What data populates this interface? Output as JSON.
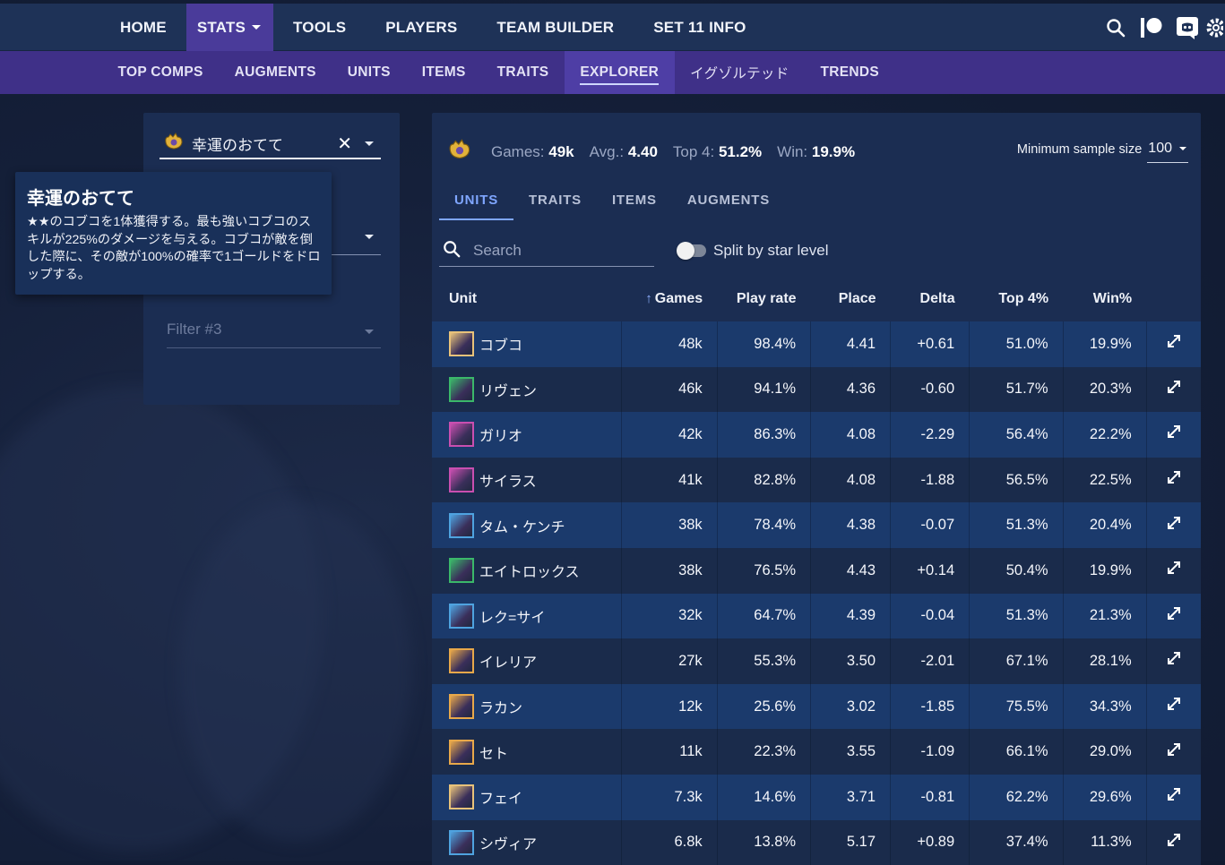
{
  "topnav": {
    "items": [
      {
        "label": "HOME"
      },
      {
        "label": "STATS"
      },
      {
        "label": "TOOLS"
      },
      {
        "label": "PLAYERS"
      },
      {
        "label": "TEAM BUILDER"
      },
      {
        "label": "SET 11 INFO"
      }
    ],
    "icons": [
      "search-icon",
      "patreon-icon",
      "discord-icon",
      "settings-icon"
    ]
  },
  "subnav": {
    "items": [
      {
        "label": "TOP COMPS"
      },
      {
        "label": "AUGMENTS"
      },
      {
        "label": "UNITS"
      },
      {
        "label": "ITEMS"
      },
      {
        "label": "TRAITS"
      },
      {
        "label": "EXPLORER"
      },
      {
        "label": "イグゾルテッド"
      },
      {
        "label": "TRENDS"
      }
    ]
  },
  "filters": {
    "filter1_value": "幸運のおてて",
    "filter3_placeholder": "Filter #3"
  },
  "tooltip": {
    "title": "幸運のおてて",
    "description": "★★のコブコを1体獲得する。最も強いコブコのスキルが225%のダメージを与える。コブコが敵を倒した際に、その敵が100%の確率で1ゴールドをドロップする。"
  },
  "summary": {
    "games_label": "Games:",
    "games_value": "49k",
    "avg_label": "Avg.:",
    "avg_value": "4.40",
    "top4_label": "Top 4:",
    "top4_value": "51.2%",
    "win_label": "Win:",
    "win_value": "19.9%",
    "sample_label": "Minimum sample size",
    "sample_value": "100"
  },
  "tabs": [
    {
      "label": "UNITS"
    },
    {
      "label": "TRAITS"
    },
    {
      "label": "ITEMS"
    },
    {
      "label": "AUGMENTS"
    }
  ],
  "search": {
    "placeholder": "Search"
  },
  "toggle": {
    "label": "Split by star level"
  },
  "table": {
    "headers": {
      "unit": "Unit",
      "games": "Games",
      "play": "Play rate",
      "place": "Place",
      "delta": "Delta",
      "top4": "Top 4%",
      "win": "Win%"
    },
    "rows": [
      {
        "unit": "コブコ",
        "games": "48k",
        "play": "98.4%",
        "place": "4.41",
        "delta": "+0.61",
        "top4": "51.0%",
        "win": "19.9%",
        "color": "#e8c27a"
      },
      {
        "unit": "リヴェン",
        "games": "46k",
        "play": "94.1%",
        "place": "4.36",
        "delta": "-0.60",
        "top4": "51.7%",
        "win": "20.3%",
        "color": "#3bb86a"
      },
      {
        "unit": "ガリオ",
        "games": "42k",
        "play": "86.3%",
        "place": "4.08",
        "delta": "-2.29",
        "top4": "56.4%",
        "win": "22.2%",
        "color": "#c94fb0"
      },
      {
        "unit": "サイラス",
        "games": "41k",
        "play": "82.8%",
        "place": "4.08",
        "delta": "-1.88",
        "top4": "56.5%",
        "win": "22.5%",
        "color": "#c94fb0"
      },
      {
        "unit": "タム・ケンチ",
        "games": "38k",
        "play": "78.4%",
        "place": "4.38",
        "delta": "-0.07",
        "top4": "51.3%",
        "win": "20.4%",
        "color": "#4fa3e0"
      },
      {
        "unit": "エイトロックス",
        "games": "38k",
        "play": "76.5%",
        "place": "4.43",
        "delta": "+0.14",
        "top4": "50.4%",
        "win": "19.9%",
        "color": "#3bb86a"
      },
      {
        "unit": "レク=サイ",
        "games": "32k",
        "play": "64.7%",
        "place": "4.39",
        "delta": "-0.04",
        "top4": "51.3%",
        "win": "21.3%",
        "color": "#4fa3e0"
      },
      {
        "unit": "イレリア",
        "games": "27k",
        "play": "55.3%",
        "place": "3.50",
        "delta": "-2.01",
        "top4": "67.1%",
        "win": "28.1%",
        "color": "#e8a84a"
      },
      {
        "unit": "ラカン",
        "games": "12k",
        "play": "25.6%",
        "place": "3.02",
        "delta": "-1.85",
        "top4": "75.5%",
        "win": "34.3%",
        "color": "#e8a84a"
      },
      {
        "unit": "セト",
        "games": "11k",
        "play": "22.3%",
        "place": "3.55",
        "delta": "-1.09",
        "top4": "66.1%",
        "win": "29.0%",
        "color": "#e8a84a"
      },
      {
        "unit": "フェイ",
        "games": "7.3k",
        "play": "14.6%",
        "place": "3.71",
        "delta": "-0.81",
        "top4": "62.2%",
        "win": "29.6%",
        "color": "#e8c27a"
      },
      {
        "unit": "シヴィア",
        "games": "6.8k",
        "play": "13.8%",
        "place": "5.17",
        "delta": "+0.89",
        "top4": "37.4%",
        "win": "11.3%",
        "color": "#4fa3e0"
      }
    ]
  }
}
